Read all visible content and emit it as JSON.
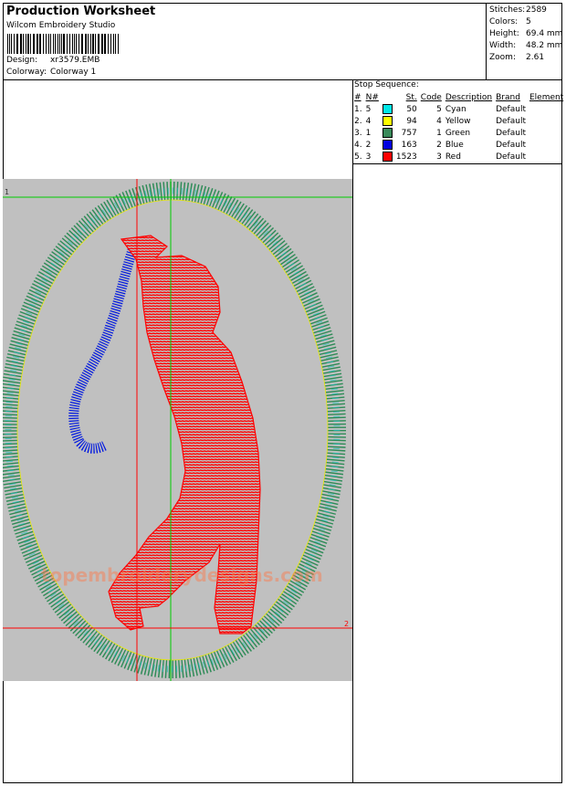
{
  "header": {
    "title": "Production Worksheet",
    "software": "Wilcom Embroidery Studio",
    "design_label": "Design:",
    "design_value": "xr3579.EMB",
    "colorway_label": "Colorway:",
    "colorway_value": "Colorway 1"
  },
  "stats": [
    {
      "label": "Stitches:",
      "value": "2589"
    },
    {
      "label": "Colors:",
      "value": "5"
    },
    {
      "label": "Height:",
      "value": "69.4 mm"
    },
    {
      "label": "Width:",
      "value": "48.2 mm"
    },
    {
      "label": "Zoom:",
      "value": "2.61"
    }
  ],
  "stop_sequence": {
    "title": "Stop Sequence:",
    "columns": [
      "#",
      "N#",
      "St.",
      "Code",
      "Description",
      "Brand",
      "Element"
    ],
    "rows": [
      {
        "idx": "1.",
        "n": "5",
        "color": "#00e8e8",
        "st": "50",
        "code": "5",
        "description": "Cyan",
        "brand": "Default",
        "element": ""
      },
      {
        "idx": "2.",
        "n": "4",
        "color": "#ffff00",
        "st": "94",
        "code": "4",
        "description": "Yellow",
        "brand": "Default",
        "element": ""
      },
      {
        "idx": "3.",
        "n": "1",
        "color": "#3a8a5a",
        "st": "757",
        "code": "1",
        "description": "Green",
        "brand": "Default",
        "element": ""
      },
      {
        "idx": "4.",
        "n": "2",
        "color": "#0000e0",
        "st": "163",
        "code": "2",
        "description": "Blue",
        "brand": "Default",
        "element": ""
      },
      {
        "idx": "5.",
        "n": "3",
        "color": "#ff0000",
        "st": "1523",
        "code": "3",
        "description": "Red",
        "brand": "Default",
        "element": ""
      }
    ]
  },
  "canvas": {
    "background": "#c0c0c0",
    "marker_1": "1",
    "marker_2": "2",
    "watermark": "topembroiderydesigns.com"
  }
}
